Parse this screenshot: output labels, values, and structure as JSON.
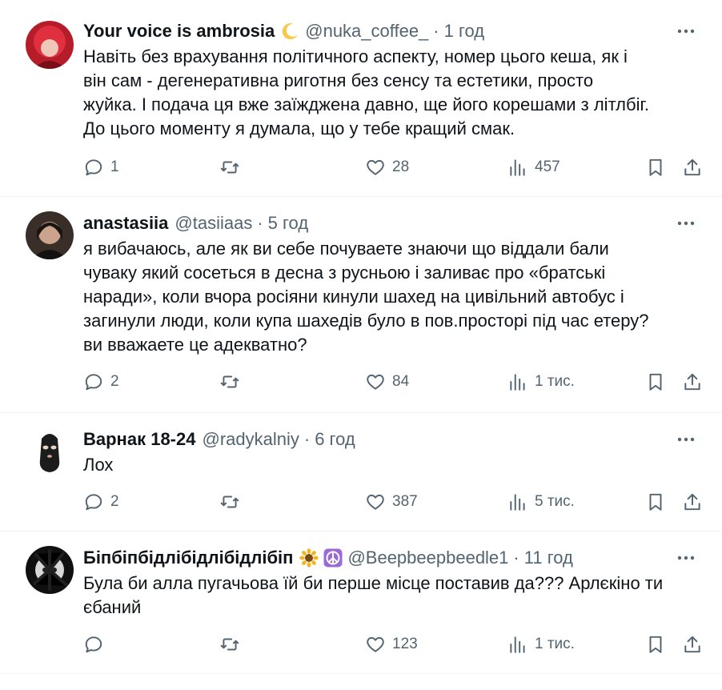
{
  "tweets": [
    {
      "name": "Your voice is ambrosia",
      "emoji": "crescent-moon",
      "handle": "@nuka_coffee_",
      "sep": "·",
      "time": "1 год",
      "text": "Навіть без врахування політичного аспекту, номер цього кеша, як і\nвін сам - дегенеративна риготня без сенсу та естетики, просто\nжуйка. І подача ця вже заїжджена давно, ще його корешами з літлбіг.\nДо цього моменту я думала, що у тебе кращий смак.",
      "replies": "1",
      "retweets": "",
      "likes": "28",
      "views": "457"
    },
    {
      "name": "anastasiia",
      "handle": "@tasiiaas",
      "sep": "·",
      "time": "5 год",
      "text": "я вибачаюсь, але як ви себе почуваете знаючи що віддали бали\nчуваку який сосеться в десна з русньою і заливає про «братські\nнаради», коли вчора росіяни кинули шахед на цивільний автобус і\nзагинули люди, коли купа шахедів було в пов.просторі під час етеру?\nви вважаете це адекватно?",
      "replies": "2",
      "retweets": "",
      "likes": "84",
      "views": "1 тис."
    },
    {
      "name": "Варнак 18-24",
      "handle": "@radykalniy",
      "sep": "·",
      "time": "6 год",
      "text": "Лох",
      "replies": "2",
      "retweets": "",
      "likes": "387",
      "views": "5 тис."
    },
    {
      "name": "Біпбіпбідлібідлібідлібіп",
      "emoji": "sunflower",
      "emoji2": "peace-symbol",
      "handle": "@Beepbeepbeedle1",
      "sep": "·",
      "time": "11 год",
      "text": "Була би алла пугачьова їй би перше місце поставив да??? Арлєкіно ти\nєбаний",
      "replies": "",
      "retweets": "",
      "likes": "123",
      "views": "1 тис."
    }
  ],
  "colors": {
    "text": "#0f1419",
    "secondary": "#536471",
    "divider": "#eff3f4"
  }
}
